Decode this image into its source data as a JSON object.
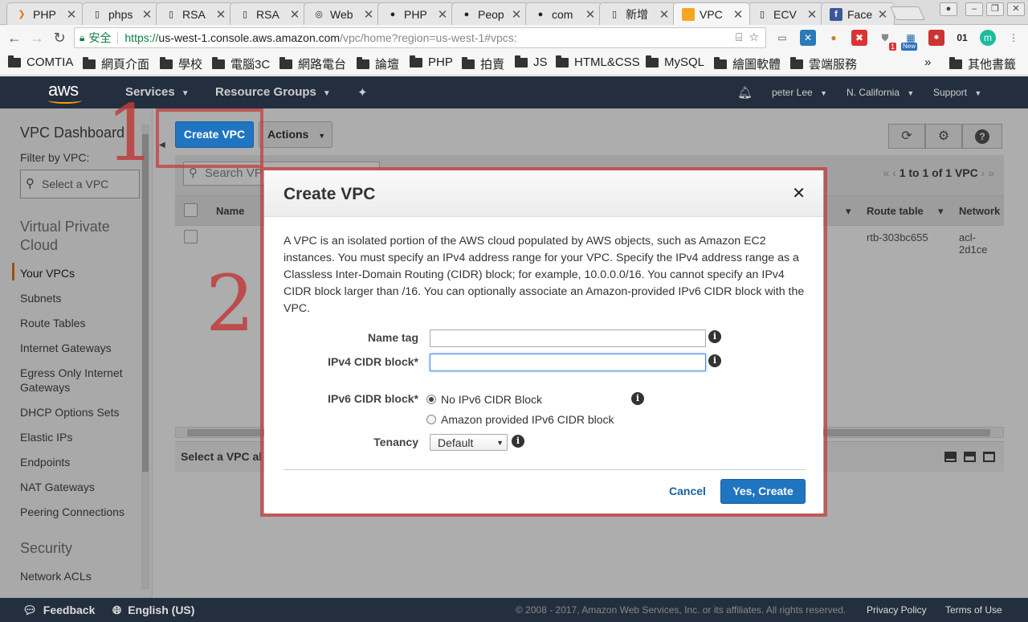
{
  "browser": {
    "tabs": [
      {
        "label": "PHP",
        "icon": "arrow-icon"
      },
      {
        "label": "phps",
        "icon": "page-icon"
      },
      {
        "label": "RSA",
        "icon": "page-icon"
      },
      {
        "label": "RSA",
        "icon": "page-icon"
      },
      {
        "label": "Web",
        "icon": "web-icon"
      },
      {
        "label": "PHP",
        "icon": "github-icon"
      },
      {
        "label": "Peop",
        "icon": "github-icon"
      },
      {
        "label": "com",
        "icon": "github-icon"
      },
      {
        "label": "新增",
        "icon": "page-icon"
      },
      {
        "label": "VPC",
        "icon": "aws-box-icon"
      },
      {
        "label": "ECV",
        "icon": "page-icon"
      },
      {
        "label": "Face",
        "icon": "facebook-icon"
      }
    ],
    "secure_label": "安全",
    "url_scheme": "https://",
    "url_domain": "us-west-1.console.aws.amazon.com",
    "url_path": "/vpc/home?region=us-west-1#vpcs:",
    "ext_badge_count": "1",
    "ext_badge_new": "New",
    "ext_text_01": "01",
    "bookmarks": [
      "COMTIA",
      "網頁介面",
      "學校",
      "電腦3C",
      "網路電台",
      "論壇",
      "PHP",
      "拍賣",
      "JS",
      "HTML&CSS",
      "MySQL",
      "繪圖軟體",
      "雲端服務"
    ],
    "bookmarks_more": "»",
    "other_bookmarks": "其他書籤"
  },
  "aws_header": {
    "logo": "aws",
    "services": "Services",
    "resource_groups": "Resource Groups",
    "user": "peter Lee",
    "region": "N. California",
    "support": "Support"
  },
  "sidebar": {
    "title": "VPC Dashboard",
    "filter_label": "Filter by VPC:",
    "select_placeholder": "Select a VPC",
    "section_vpc": "Virtual Private Cloud",
    "items": [
      "Your VPCs",
      "Subnets",
      "Route Tables",
      "Internet Gateways",
      "Egress Only Internet Gateways",
      "DHCP Options Sets",
      "Elastic IPs",
      "Endpoints",
      "NAT Gateways",
      "Peering Connections"
    ],
    "section_security": "Security",
    "security_items": [
      "Network ACLs"
    ]
  },
  "main": {
    "create_btn": "Create VPC",
    "actions_btn": "Actions",
    "search_placeholder": "Search VP",
    "paging": "1 to 1 of 1 VPC",
    "columns": {
      "name": "Name",
      "route_table": "Route table",
      "network": "Network"
    },
    "row": {
      "route_table": "rtb-303bc655",
      "network_acl": "acl-2d1ce"
    },
    "details_hint": "Select a VPC al"
  },
  "modal": {
    "title": "Create VPC",
    "description": "A VPC is an isolated portion of the AWS cloud populated by AWS objects, such as Amazon EC2 instances. You must specify an IPv4 address range for your VPC. Specify the IPv4 address range as a Classless Inter-Domain Routing (CIDR) block; for example, 10.0.0.0/16. You cannot specify an IPv4 CIDR block larger than /16. You can optionally associate an Amazon-provided IPv6 CIDR block with the VPC.",
    "name_tag_label": "Name tag",
    "name_tag_value": "",
    "ipv4_label": "IPv4 CIDR block*",
    "ipv4_value": "",
    "ipv6_label": "IPv6 CIDR block*",
    "ipv6_option_none": "No IPv6 CIDR Block",
    "ipv6_option_amazon": "Amazon provided IPv6 CIDR block",
    "tenancy_label": "Tenancy",
    "tenancy_value": "Default",
    "cancel": "Cancel",
    "create": "Yes, Create"
  },
  "annotations": {
    "step1": "1",
    "step2": "2",
    "color": "#c83c3c"
  },
  "footer": {
    "feedback": "Feedback",
    "language": "English (US)",
    "copyright": "© 2008 - 2017, Amazon Web Services, Inc. or its affiliates. All rights reserved.",
    "privacy": "Privacy Policy",
    "terms": "Terms of Use"
  },
  "colors": {
    "aws_nav": "#232f3e",
    "primary": "#2075c0",
    "accent_orange": "#ff9900"
  }
}
